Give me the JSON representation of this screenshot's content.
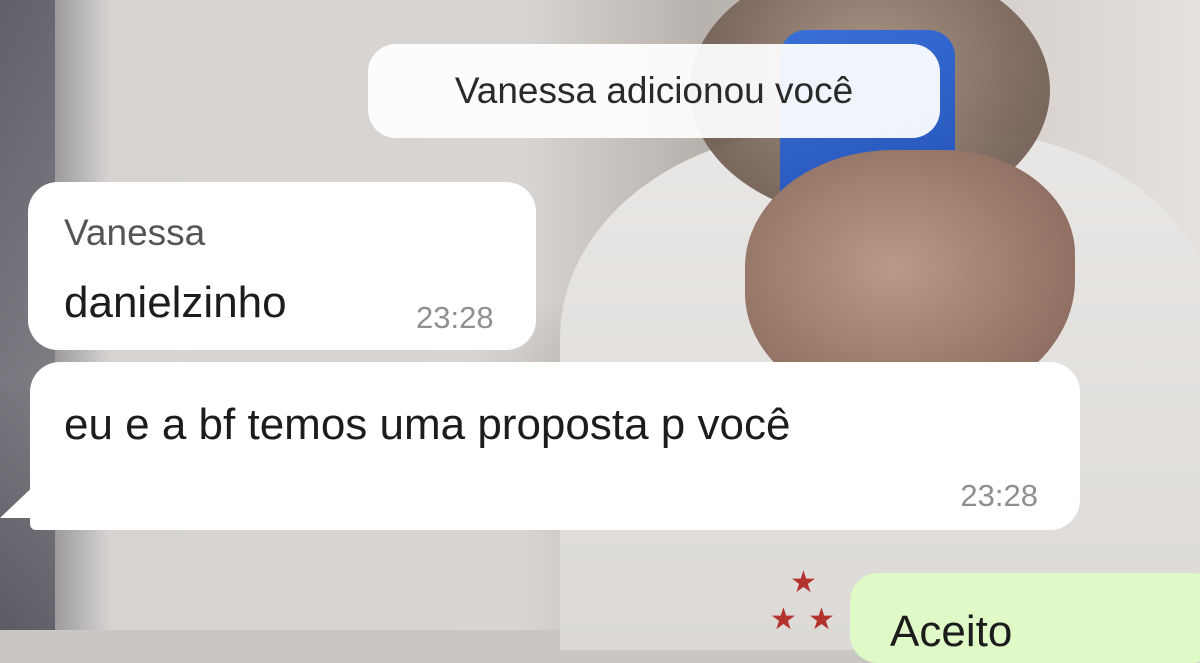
{
  "system_message": "Vanessa adicionou você",
  "messages": [
    {
      "sender": "Vanessa",
      "text": "danielzinho",
      "time": "23:28",
      "direction": "incoming"
    },
    {
      "text": "eu e a bf temos uma proposta p você",
      "time": "23:28",
      "direction": "incoming"
    },
    {
      "text": "Aceito",
      "direction": "outgoing"
    }
  ],
  "colors": {
    "incoming_bubble": "#ffffff",
    "outgoing_bubble": "#dff9c7",
    "timestamp": "#8f8f8f"
  }
}
